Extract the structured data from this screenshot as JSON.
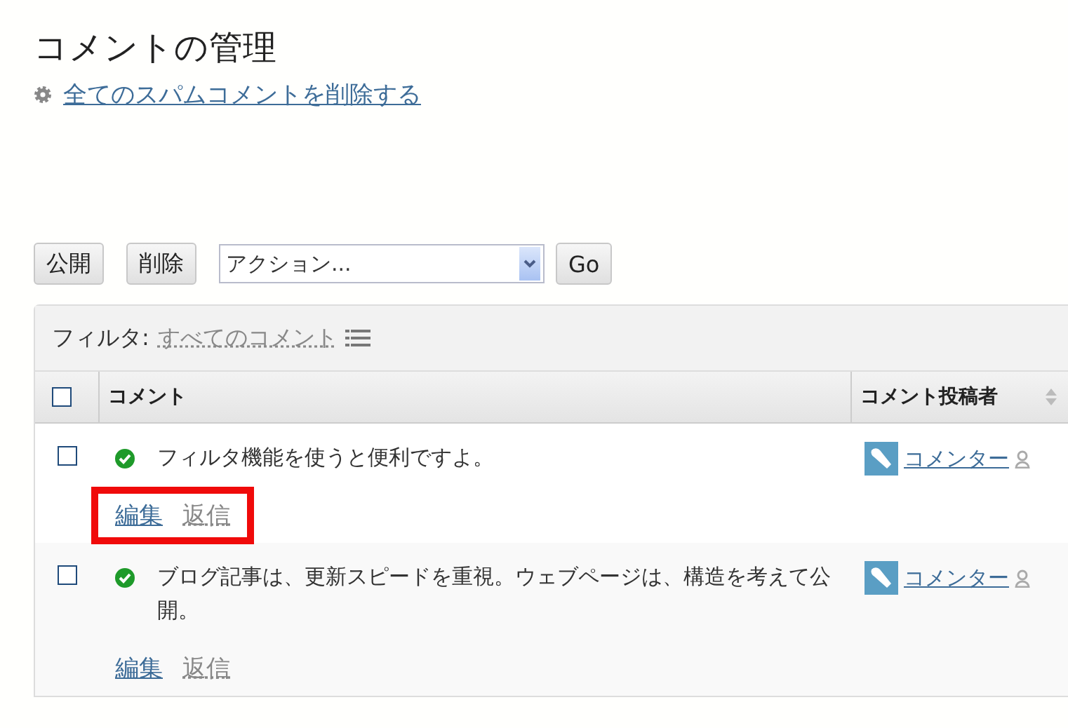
{
  "page_title": "コメントの管理",
  "spam_link": "全てのスパムコメントを削除する",
  "toolbar": {
    "buttons": [
      "公開",
      "削除"
    ],
    "action_select": {
      "value": "アクション..."
    },
    "go_button": "Go"
  },
  "filter": {
    "label": "フィルタ:",
    "value": "すべてのコメント"
  },
  "table": {
    "select_all": {
      "checked": false
    },
    "columns": [
      "コメント",
      "コメント投稿者"
    ],
    "rows": [
      {
        "checked": false,
        "published": true,
        "text": "フィルタ機能を使うと便利ですよ。",
        "actions": [
          "編集",
          "返信"
        ],
        "highlighted": true,
        "author": "コメンター"
      },
      {
        "checked": false,
        "published": true,
        "text": "ブログ記事は、更新スピードを重視。ウェブページは、構造を考えて公開。",
        "actions": [
          "編集",
          "返信"
        ],
        "highlighted": false,
        "author": "コメンター"
      }
    ]
  }
}
